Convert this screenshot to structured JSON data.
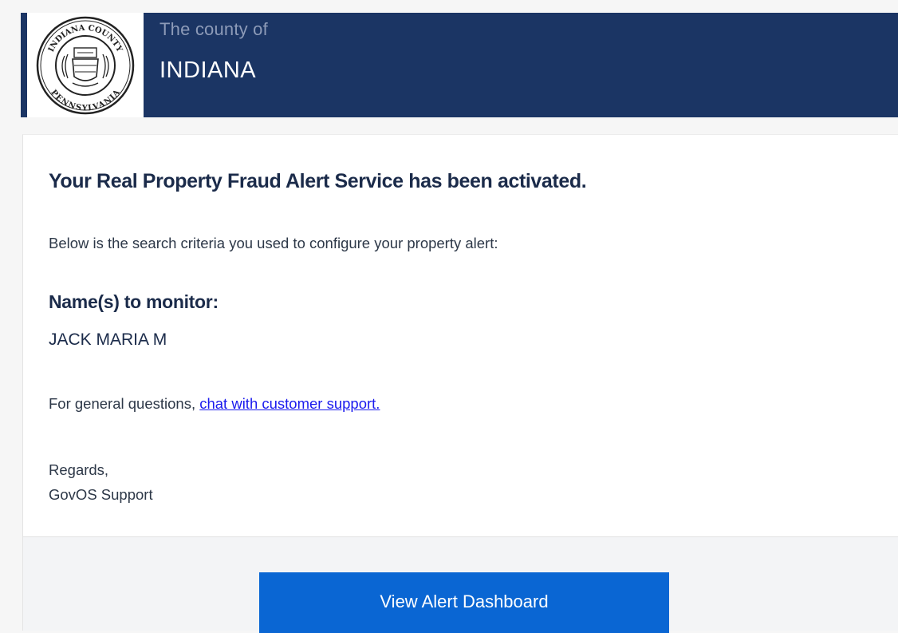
{
  "header": {
    "county_prefix": "The county of",
    "county_name": "INDIANA",
    "seal": {
      "icon": "county-seal-icon",
      "top_text": "INDIANA COUNTY",
      "bottom_text": "PENNSYLVANIA"
    }
  },
  "body": {
    "headline": "Your Real Property Fraud Alert Service has been activated.",
    "intro": "Below is the search criteria you used to configure your property alert:",
    "monitor_label": "Name(s) to monitor:",
    "monitor_name": "JACK MARIA M",
    "support_prefix": "For general questions,",
    "support_link": "chat with customer support.",
    "regards": "Regards,",
    "signature": "GovOS Support"
  },
  "footer": {
    "button_label": "View Alert Dashboard"
  },
  "colors": {
    "header_bg": "#1b3564",
    "button_bg": "#0a66d3",
    "link": "#1a1aee"
  }
}
